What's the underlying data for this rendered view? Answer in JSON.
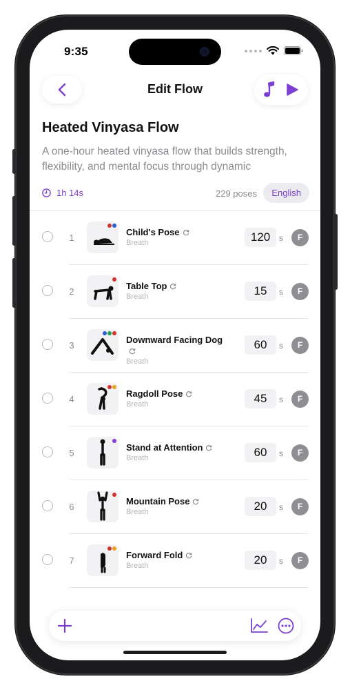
{
  "status": {
    "time": "9:35"
  },
  "nav": {
    "title": "Edit Flow",
    "back_icon": "chevron-left-icon",
    "music_icon": "music-note-icon",
    "play_icon": "play-icon"
  },
  "flow": {
    "title": "Heated Vinyasa Flow",
    "description": "A one-hour heated vinyasa flow that builds strength, flexibility, and mental focus through dynamic",
    "duration": "1h 14s",
    "pose_count": "229 poses",
    "language": "English"
  },
  "colors": {
    "accent": "#7b3fd1",
    "badge": "#8e8e93"
  },
  "poses": [
    {
      "index": "1",
      "name": "Child's Pose",
      "sub": "Breath",
      "seconds": "120",
      "unit": "s",
      "badge": "F",
      "tags": [
        "#d1342c",
        "#2d5bd4"
      ]
    },
    {
      "index": "2",
      "name": "Table Top",
      "sub": "Breath",
      "seconds": "15",
      "unit": "s",
      "badge": "F",
      "tags": [
        "#d1342c"
      ]
    },
    {
      "index": "3",
      "name": "Downward Facing Dog",
      "sub": "Breath",
      "seconds": "60",
      "unit": "s",
      "badge": "F",
      "tags": [
        "#2d5bd4",
        "#1f9e53",
        "#d1342c"
      ]
    },
    {
      "index": "4",
      "name": "Ragdoll Pose",
      "sub": "Breath",
      "seconds": "45",
      "unit": "s",
      "badge": "F",
      "tags": [
        "#d1342c",
        "#f0a020"
      ]
    },
    {
      "index": "5",
      "name": "Stand at Attention",
      "sub": "Breath",
      "seconds": "60",
      "unit": "s",
      "badge": "F",
      "tags": [
        "#8a3ad1"
      ]
    },
    {
      "index": "6",
      "name": "Mountain Pose",
      "sub": "Breath",
      "seconds": "20",
      "unit": "s",
      "badge": "F",
      "tags": [
        "#d1342c"
      ]
    },
    {
      "index": "7",
      "name": "Forward Fold",
      "sub": "Breath",
      "seconds": "20",
      "unit": "s",
      "badge": "F",
      "tags": [
        "#d1342c",
        "#f0a020"
      ]
    }
  ],
  "toolbar": {
    "add_icon": "plus-icon",
    "chart_icon": "chart-line-icon",
    "more_icon": "ellipsis-circle-icon"
  }
}
